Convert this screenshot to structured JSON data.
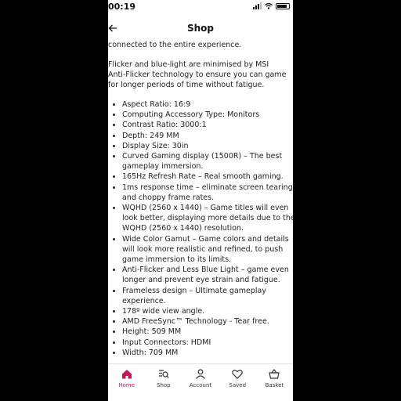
{
  "status_bar": {
    "time": "00:19",
    "icons": [
      "signal-icon",
      "wifi-icon",
      "battery-icon"
    ]
  },
  "header": {
    "title": "Shop",
    "back_icon": "back-arrow-icon"
  },
  "content": {
    "intro_fragment": "connected to the entire experience.",
    "paragraph": "Flicker and blue-light are minimised by MSI Anti-Flicker technology to ensure you can game for longer periods of time without fatigue.",
    "specs": [
      "Aspect Ratio: 16:9",
      "Computing Accessory Type: Monitors",
      "Contrast Ratio: 3000:1",
      "Depth: 249 MM",
      "Display Size: 30in",
      "Curved Gaming display (1500R) – The best gameplay immersion.",
      "165Hz Refresh Rate – Real smooth gaming.",
      "1ms response time – eliminate screen tearing and choppy frame rates.",
      "WQHD (2560 x 1440) – Game titles will even look better, displaying more details due to the WQHD (2560 x 1440) resolution.",
      "Wide Color Gamut – Game colors and details will look more realistic and refined, to push game immersion to its limits.",
      "Anti-Flicker and Less Blue Light – game even longer and prevent eye strain and fatigue.",
      "Frameless design – Ultimate gameplay experience.",
      "178º wide view angle.",
      "AMD FreeSync™ Technology - Tear free.",
      "Height: 509 MM",
      "Input Connectors: HDMI",
      "Width: 709 MM"
    ]
  },
  "tab_bar": {
    "active_color": "#c2185b",
    "tabs": [
      {
        "label": "Home",
        "icon": "home-icon",
        "active": true
      },
      {
        "label": "Shop",
        "icon": "search-list-icon",
        "active": false
      },
      {
        "label": "Account",
        "icon": "user-icon",
        "active": false
      },
      {
        "label": "Saved",
        "icon": "heart-icon",
        "active": false
      },
      {
        "label": "Basket",
        "icon": "basket-icon",
        "active": false
      }
    ]
  }
}
